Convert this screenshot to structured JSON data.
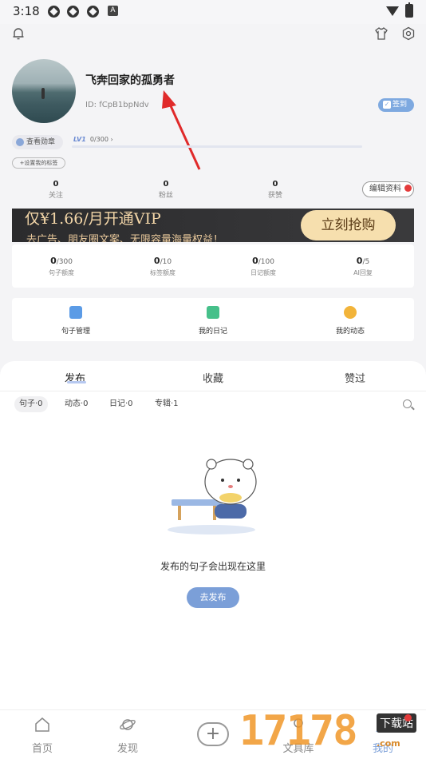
{
  "status_bar": {
    "time": "3:18"
  },
  "profile": {
    "nickname": "飞奔回家的孤勇者",
    "user_id": "ID: fCpB1bpNdv",
    "checkin_label": "签到",
    "medal_label": "查看勋章",
    "level_badge": "LV1",
    "level_progress": "0/300",
    "level_progress_fraction": 0,
    "set_tags_label": "+设置我的标签",
    "edit_profile_label": "编辑资料"
  },
  "stats": [
    {
      "value": "0",
      "label": "关注"
    },
    {
      "value": "0",
      "label": "粉丝"
    },
    {
      "value": "0",
      "label": "获赞"
    }
  ],
  "vip_banner": {
    "headline": "仅¥1.66/月开通VIP",
    "subline": "去广告、朋友圈文案、无限容量海量权益！",
    "button_label": "立刻抢购"
  },
  "quotas": [
    {
      "used": "0",
      "total": "/300",
      "label": "句子额度"
    },
    {
      "used": "0",
      "total": "/10",
      "label": "标签额度"
    },
    {
      "used": "0",
      "total": "/100",
      "label": "日记额度"
    },
    {
      "used": "0",
      "total": "/5",
      "label": "AI回复"
    }
  ],
  "features": [
    {
      "label": "句子管理",
      "icon": "sentence-edit-icon",
      "color": "#5b9be6"
    },
    {
      "label": "我的日记",
      "icon": "diary-book-icon",
      "color": "#46c08a"
    },
    {
      "label": "我的动态",
      "icon": "planet-icon",
      "color": "#f2b43a"
    }
  ],
  "tabs": [
    "发布",
    "收藏",
    "赞过"
  ],
  "filters": [
    "句子·0",
    "动态·0",
    "日记·0",
    "专辑·1"
  ],
  "empty_state": {
    "message": "发布的句子会出现在这里",
    "button_label": "去发布"
  },
  "bottom_nav": [
    {
      "label": "首页",
      "icon": "home-icon"
    },
    {
      "label": "发现",
      "icon": "planet-icon"
    },
    {
      "label": "",
      "icon": "plus-icon"
    },
    {
      "label": "文具库",
      "icon": "stationery-icon"
    },
    {
      "label": "我的",
      "icon": "profile-icon"
    }
  ],
  "watermark": {
    "digits": "17178",
    "site": "下载站",
    "domain": ".com"
  },
  "colors": {
    "accent": "#7b9fd8",
    "vip_gold": "#f6dfae",
    "badge_red": "#e43b3b"
  }
}
